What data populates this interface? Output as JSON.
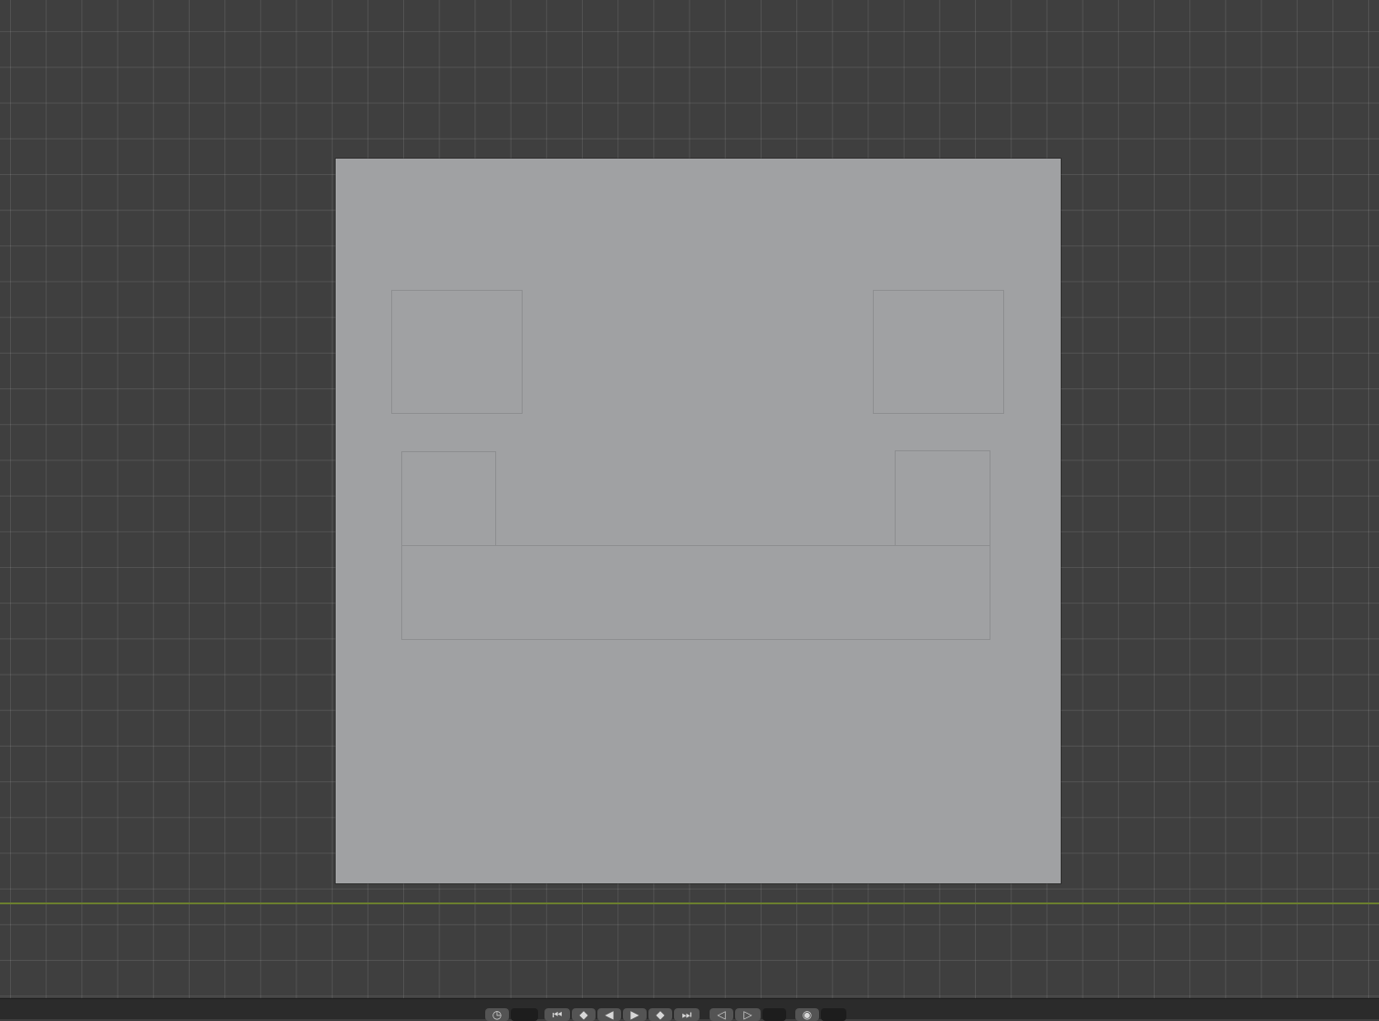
{
  "viewport": {
    "background_color": "#3f3f3f",
    "grid_color": "rgba(255,255,255,0.10)",
    "x_axis_color": "#6b7f2e",
    "plane_color": "#a0a1a3",
    "edge_color": "#8d8e90"
  },
  "timeline": {
    "icons": [
      "clock-icon",
      "jump-to-start-icon",
      "jump-to-keyframe-previous-icon",
      "play-reverse-icon",
      "play-icon",
      "jump-to-keyframe-next-icon",
      "jump-to-end-icon",
      "keyframe-previous-icon",
      "keyframe-next-icon",
      "record-icon"
    ]
  }
}
